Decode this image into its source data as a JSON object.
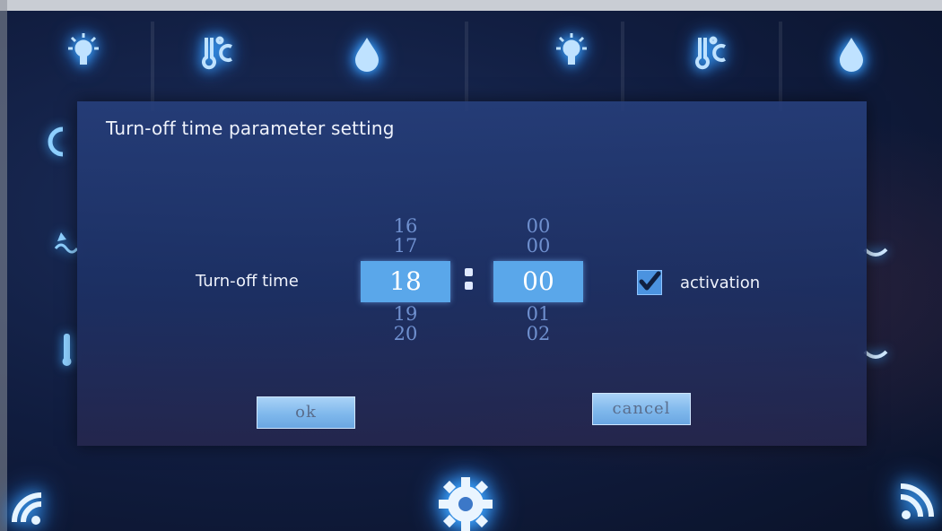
{
  "top_icons": [
    {
      "name": "lightbulb-icon"
    },
    {
      "name": "thermometer-icon"
    },
    {
      "name": "water-drop-icon"
    },
    {
      "name": "lightbulb-icon"
    },
    {
      "name": "thermometer-icon"
    },
    {
      "name": "water-drop-icon"
    }
  ],
  "dialog": {
    "title": "Turn-off time parameter setting",
    "time_label": "Turn-off time",
    "hour_picker": {
      "options_above": [
        "16",
        "17"
      ],
      "selected": "18",
      "options_below": [
        "19",
        "20"
      ]
    },
    "minute_picker": {
      "options_above": [
        "00",
        "00"
      ],
      "selected": "00",
      "options_below": [
        "01",
        "02"
      ]
    },
    "separator": ":",
    "activation": {
      "label": "activation",
      "checked": true
    },
    "ok_label": "ok",
    "cancel_label": "cancel"
  },
  "bottom_icons": [
    "wifi-left-icon",
    "settings-gear-icon",
    "wifi-right-icon"
  ],
  "colors": {
    "accent": "#5aa7ea",
    "button": "#7fb8ec",
    "glow": "#3fa9ff"
  }
}
